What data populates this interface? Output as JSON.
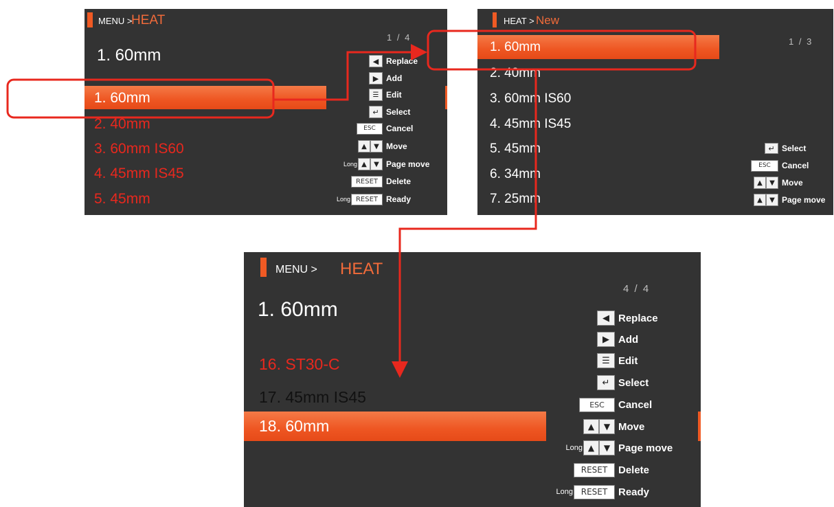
{
  "colors": {
    "accent": "#f05a24",
    "callout": "#e8281e",
    "screen": "#333333"
  },
  "screen1": {
    "header_small": "MENU >",
    "header_big": "HEAT",
    "page": "1 / 4",
    "title": "1. 60mm",
    "items": [
      "1. 60mm",
      "2. 40mm",
      "3. 60mm IS60",
      "4. 45mm IS45",
      "5. 45mm"
    ],
    "help": {
      "replace": "Replace",
      "add": "Add",
      "edit": "Edit",
      "select": "Select",
      "esc": "ESC",
      "cancel": "Cancel",
      "move": "Move",
      "long": "Long",
      "page_move": "Page move",
      "reset": "RESET",
      "delete": "Delete",
      "ready": "Ready"
    }
  },
  "screen2": {
    "header_small": "HEAT >",
    "header_big": "New",
    "page": "1 / 3",
    "items": [
      "1. 60mm",
      "2. 40mm",
      "3. 60mm IS60",
      "4. 45mm IS45",
      "5. 45mm",
      "6. 34mm",
      "7. 25mm"
    ],
    "help": {
      "select": "Select",
      "esc": "ESC",
      "cancel": "Cancel",
      "move": "Move",
      "page_move": "Page move"
    }
  },
  "screen3": {
    "header_small": "MENU >",
    "header_big": "HEAT",
    "page": "4 / 4",
    "title": "1. 60mm",
    "items": [
      "16. ST30-C",
      "17. 45mm IS45",
      "18. 60mm"
    ],
    "help": {
      "replace": "Replace",
      "add": "Add",
      "edit": "Edit",
      "select": "Select",
      "esc": "ESC",
      "cancel": "Cancel",
      "move": "Move",
      "long": "Long",
      "page_move": "Page move",
      "reset": "RESET",
      "delete": "Delete",
      "ready": "Ready"
    }
  },
  "icons": [
    "left-arrow-key-icon",
    "right-arrow-key-icon",
    "edit-key-icon",
    "enter-key-icon",
    "up-arrow-key-icon",
    "down-arrow-key-icon",
    "arrow-icon"
  ]
}
